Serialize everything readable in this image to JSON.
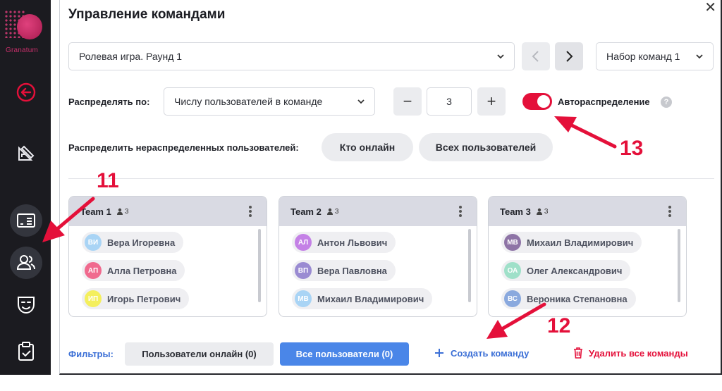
{
  "sidebar": {
    "logo_text": "Granatum",
    "icons": [
      "back-arrow-icon",
      "geometry-tools-icon",
      "presentation-icon",
      "users-icon",
      "theater-mask-icon",
      "clipboard-check-icon"
    ]
  },
  "dialog": {
    "title": "Управление командами",
    "close_symbol": "✕"
  },
  "round_select": {
    "value": "Ролевая игра. Раунд 1"
  },
  "team_set_select": {
    "value": "Набор команд 1"
  },
  "distribute": {
    "label": "Распределять по:",
    "mode_value": "Числу пользователей в команде",
    "stepper_value": "3",
    "minus": "−",
    "plus": "+",
    "auto_label": "Автораспределение",
    "auto_enabled": true,
    "help_symbol": "?"
  },
  "unassigned": {
    "label": "Распределить нераспределенных пользователей:",
    "online_button": "Кто онлайн",
    "all_button": "Всех пользователей"
  },
  "teams": [
    {
      "name": "Team 1",
      "count": "3",
      "members": [
        {
          "initials": "ВИ",
          "name": "Вера Игоревна",
          "color": "#a9d4f5"
        },
        {
          "initials": "АП",
          "name": "Алла Петровна",
          "color": "#f06a8e"
        },
        {
          "initials": "ИП",
          "name": "Игорь Петрович",
          "color": "#f4ef5d"
        }
      ]
    },
    {
      "name": "Team 2",
      "count": "3",
      "members": [
        {
          "initials": "АЛ",
          "name": "Антон Львович",
          "color": "#c481e6"
        },
        {
          "initials": "ВП",
          "name": "Вера Павловна",
          "color": "#9a8bd2"
        },
        {
          "initials": "МВ",
          "name": "Михаил Владимирович",
          "color": "#a9d4f5"
        }
      ]
    },
    {
      "name": "Team 3",
      "count": "3",
      "members": [
        {
          "initials": "МВ",
          "name": "Михаил Владимирович",
          "color": "#8e74a6"
        },
        {
          "initials": "ОА",
          "name": "Олег Александрович",
          "color": "#9fe0c9"
        },
        {
          "initials": "ВС",
          "name": "Вероника Степановна",
          "color": "#8aa9de"
        }
      ]
    }
  ],
  "footer": {
    "filters_label": "Фильтры:",
    "online_filter": "Пользователи онлайн (0)",
    "all_filter": "Все пользователи (0)",
    "create_team": "Создать команду",
    "delete_all": "Удалить все команды"
  },
  "annotations": [
    "11",
    "12",
    "13"
  ],
  "colors": {
    "accent_red": "#e4103a",
    "accent_blue": "#3b6fd6",
    "sidebar_bg": "#1b1b20"
  }
}
